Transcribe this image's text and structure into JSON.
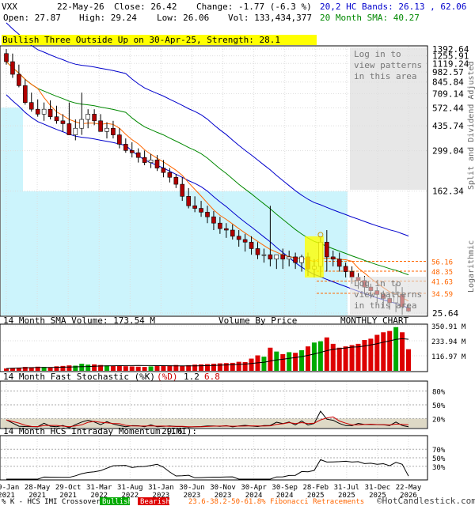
{
  "header": {
    "symbol": "VXX",
    "date": "22-May-26",
    "close": "Close: 26.42",
    "change": "Change: -1.77 (-6.3 %)",
    "open": "Open: 27.87",
    "high": "High: 29.24",
    "low": "Low: 26.06",
    "vol": "Vol: 133,434,377",
    "bands": "20,2 HC Bands: 26.13 , 62.06",
    "sma": "20 Month SMA: 40.27"
  },
  "colors": {
    "up": "#00aa00",
    "down": "#dd0000",
    "band": "#0000cc",
    "sma": "#008800",
    "fib": "#ff6600",
    "vbp": "#ccf4fc",
    "pattern": "#ffff00",
    "volume_sma": "#000000"
  },
  "pattern_label": "Bullish Three Outside Up on 30-Apr-25, Strength: 28.1",
  "login_text": [
    "Log in to",
    "view patterns",
    "in this area"
  ],
  "price_panel": {
    "y_ticks": [
      "1392.64",
      "1255.91",
      "1119.24",
      "982.57",
      "845.84",
      "709.14",
      "572.44",
      "435.74",
      "299.04",
      "162.34",
      "25.64"
    ],
    "scale_label": "Logarithmic",
    "axis_title": "Split and Dividend Adjusted",
    "fib_levels": [
      "56.16",
      "48.35",
      "41.63",
      "34.59"
    ],
    "footer_left": "14 Month SMA Volume: 173.54 M",
    "footer_mid": "Volume By Price",
    "footer_right": "MONTHLY CHART"
  },
  "volume_panel": {
    "y_ticks": [
      "350.91 M",
      "233.94 M",
      "116.97 M"
    ]
  },
  "stoch_panel": {
    "title": "14 Month Fast Stochastic (%K)",
    "d_label": "(%D)",
    "k_value": "1.2",
    "d_value": "6.8",
    "y_ticks": [
      "80%",
      "50%",
      "20%"
    ]
  },
  "momentum_panel": {
    "title": "14 Month HCS Intraday Momentum (IMI):",
    "value": "29.6",
    "y_ticks": [
      "70%",
      "50%",
      "30%"
    ]
  },
  "x_axis": {
    "labels": [
      [
        "29-Jan",
        "2021"
      ],
      [
        "28-May",
        "2021"
      ],
      [
        "29-Oct",
        "2021"
      ],
      [
        "31-Mar",
        "2022"
      ],
      [
        "31-Aug",
        "2022"
      ],
      [
        "31-Jan",
        "2023"
      ],
      [
        "30-Jun",
        "2023"
      ],
      [
        "30-Nov",
        "2023"
      ],
      [
        "30-Apr",
        "2024"
      ],
      [
        "30-Sep",
        "2024"
      ],
      [
        "28-Feb",
        "2025"
      ],
      [
        "31-Jul",
        "2025"
      ],
      [
        "31-Dec",
        "2025"
      ],
      [
        "22-May",
        "2026"
      ]
    ]
  },
  "legend": {
    "crossover": "% K - HCS IMI Crossover:",
    "bullish": "Bullish",
    "bearish": "Bearish",
    "fib": "23.6-38.2-50-61.8% Fibonacci Retracements",
    "credit": "©HotCandlestick.com"
  },
  "chart_data": {
    "type": "candlestick",
    "periodicity": "monthly",
    "months": [
      "2021-01",
      "2021-02",
      "2021-03",
      "2021-04",
      "2021-05",
      "2021-06",
      "2021-07",
      "2021-08",
      "2021-09",
      "2021-10",
      "2021-11",
      "2021-12",
      "2022-01",
      "2022-02",
      "2022-03",
      "2022-04",
      "2022-05",
      "2022-06",
      "2022-07",
      "2022-08",
      "2022-09",
      "2022-10",
      "2022-11",
      "2022-12",
      "2023-01",
      "2023-02",
      "2023-03",
      "2023-04",
      "2023-05",
      "2023-06",
      "2023-07",
      "2023-08",
      "2023-09",
      "2023-10",
      "2023-11",
      "2023-12",
      "2024-01",
      "2024-02",
      "2024-03",
      "2024-04",
      "2024-05",
      "2024-06",
      "2024-07",
      "2024-08",
      "2024-09",
      "2024-10",
      "2024-11",
      "2024-12",
      "2025-01",
      "2025-02",
      "2025-03",
      "2025-04",
      "2025-05",
      "2025-06",
      "2025-07",
      "2025-08",
      "2025-09",
      "2025-10",
      "2025-11",
      "2025-12",
      "2026-01",
      "2026-02",
      "2026-03",
      "2026-04",
      "2026-05"
    ],
    "open": [
      1300,
      1150,
      950,
      800,
      620,
      560,
      520,
      560,
      500,
      470,
      450,
      380,
      420,
      480,
      520,
      470,
      400,
      420,
      380,
      330,
      300,
      290,
      270,
      250,
      260,
      230,
      215,
      200,
      180,
      150,
      130,
      125,
      118,
      110,
      100,
      92,
      90,
      82,
      78,
      75,
      68,
      62,
      62,
      58,
      62,
      58,
      60,
      55,
      60,
      50,
      52,
      75,
      60,
      58,
      52,
      48,
      44,
      42,
      38,
      36,
      34,
      32,
      30,
      34,
      27.87
    ],
    "high": [
      1392,
      1300,
      1100,
      880,
      720,
      650,
      620,
      640,
      590,
      520,
      620,
      480,
      720,
      560,
      560,
      520,
      460,
      470,
      420,
      360,
      340,
      310,
      300,
      285,
      280,
      260,
      230,
      210,
      200,
      170,
      150,
      140,
      130,
      120,
      110,
      100,
      98,
      90,
      85,
      82,
      75,
      68,
      130,
      62,
      68,
      66,
      64,
      62,
      64,
      58,
      80,
      90,
      66,
      64,
      55,
      52,
      47,
      45,
      40,
      38,
      36,
      34,
      40,
      38,
      29.24
    ],
    "low": [
      1100,
      900,
      780,
      600,
      540,
      500,
      470,
      480,
      450,
      400,
      380,
      350,
      380,
      420,
      440,
      400,
      360,
      360,
      310,
      290,
      270,
      250,
      240,
      230,
      220,
      200,
      185,
      170,
      140,
      125,
      118,
      110,
      100,
      90,
      85,
      80,
      78,
      70,
      65,
      62,
      58,
      55,
      52,
      50,
      50,
      52,
      50,
      48,
      45,
      44,
      44,
      48,
      52,
      48,
      44,
      40,
      37,
      34,
      32,
      30,
      28,
      27,
      26,
      25,
      26.06
    ],
    "close": [
      1150,
      950,
      800,
      620,
      560,
      520,
      560,
      500,
      470,
      450,
      380,
      420,
      480,
      520,
      470,
      400,
      420,
      380,
      330,
      300,
      290,
      270,
      250,
      260,
      230,
      215,
      200,
      180,
      150,
      130,
      125,
      118,
      110,
      100,
      92,
      90,
      82,
      78,
      75,
      68,
      62,
      62,
      58,
      62,
      58,
      60,
      55,
      60,
      50,
      52,
      75,
      60,
      58,
      52,
      48,
      44,
      42,
      38,
      36,
      34,
      32,
      30,
      34,
      28.19,
      26.42
    ],
    "volume_millions": [
      18,
      22,
      25,
      30,
      28,
      32,
      30,
      26,
      35,
      38,
      42,
      40,
      55,
      48,
      50,
      45,
      42,
      40,
      38,
      36,
      34,
      32,
      30,
      34,
      40,
      38,
      42,
      45,
      40,
      44,
      48,
      50,
      52,
      55,
      58,
      60,
      62,
      70,
      68,
      95,
      120,
      110,
      180,
      150,
      130,
      145,
      140,
      160,
      190,
      220,
      230,
      260,
      210,
      180,
      190,
      200,
      210,
      240,
      250,
      280,
      300,
      310,
      340,
      300,
      168
    ],
    "vol_sma_millions": 173.54,
    "hc_band_upper": 62.06,
    "hc_band_lower": 26.13,
    "sma20": 40.27,
    "stoch_k": 1.2,
    "stoch_d": 6.8,
    "imi": 29.6,
    "y_scale": "log",
    "y_range": [
      25.64,
      1392.64
    ]
  }
}
